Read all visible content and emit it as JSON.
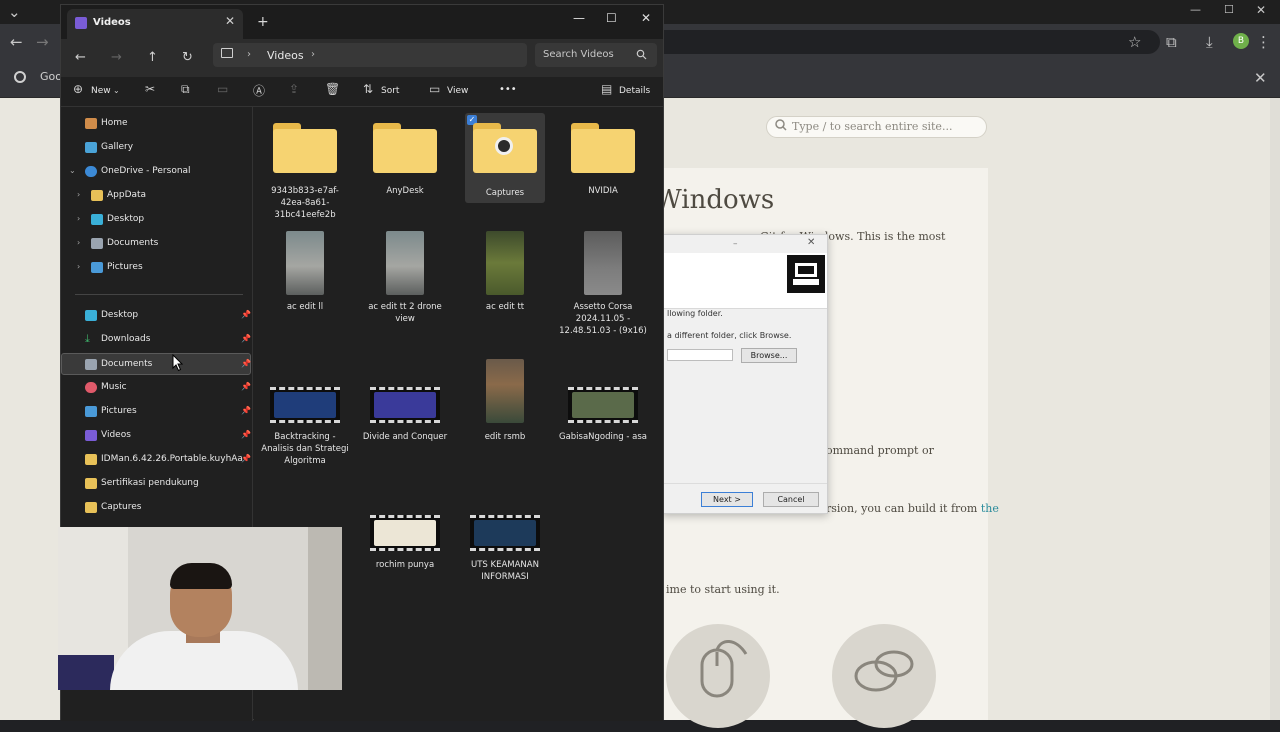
{
  "browser": {
    "bookmark_label": "Goo",
    "search_placeholder": "Type / to search entire site...",
    "heading": "Windows",
    "line1": "Git for Windows. This is the most",
    "line2": "ommand prompt or",
    "line3_text": "rsion, you can build it from",
    "line3_link": "the",
    "line4": "ime to start using it.",
    "profile_initial": "B"
  },
  "installer": {
    "text1": "llowing folder.",
    "text2": "a different folder, click Browse.",
    "browse_label": "Browse...",
    "next_label": "Next >",
    "cancel_label": "Cancel"
  },
  "explorer": {
    "tab_title": "Videos",
    "breadcrumb": "Videos",
    "search_placeholder": "Search Videos",
    "commands": {
      "new": "New",
      "sort": "Sort",
      "view": "View",
      "more": "•••",
      "details": "Details"
    },
    "nav": [
      {
        "label": "Home",
        "color": "#d08c4a"
      },
      {
        "label": "Gallery",
        "color": "#4aa3d8"
      },
      {
        "label": "OneDrive - Personal",
        "color": "#3c8ad6"
      },
      {
        "label": "AppData",
        "color": "#e8c158"
      },
      {
        "label": "Desktop",
        "color": "#3ab0d8"
      },
      {
        "label": "Documents",
        "color": "#9aa4b0"
      },
      {
        "label": "Pictures",
        "color": "#4a9ad8"
      },
      {
        "label": "Desktop",
        "color": "#3ab0d8"
      },
      {
        "label": "Downloads",
        "color": "#3fb56c"
      },
      {
        "label": "Documents",
        "color": "#9aa4b0"
      },
      {
        "label": "Music",
        "color": "#e05a6a"
      },
      {
        "label": "Pictures",
        "color": "#4a9ad8"
      },
      {
        "label": "Videos",
        "color": "#7a5cd6"
      },
      {
        "label": "IDMan.6.42.26.Portable.kuyhAa",
        "color": "#e8c158"
      },
      {
        "label": "Sertifikasi pendukung",
        "color": "#e8c158"
      },
      {
        "label": "Captures",
        "color": "#e8c158"
      }
    ],
    "items": [
      {
        "name": "9343b833-e7af-42ea-8a61-31bc41eefe2b"
      },
      {
        "name": "AnyDesk"
      },
      {
        "name": "Captures"
      },
      {
        "name": "NVIDIA"
      },
      {
        "name": "ac edit ll"
      },
      {
        "name": "ac edit tt 2 drone view"
      },
      {
        "name": "ac edit tt"
      },
      {
        "name": "Assetto Corsa 2024.11.05 - 12.48.51.03 - (9x16)"
      },
      {
        "name": "Backtracking - Analisis dan Strategi Algoritma"
      },
      {
        "name": "Divide and Conquer"
      },
      {
        "name": "edit rsmb"
      },
      {
        "name": "GabisaNgoding - asa"
      },
      {
        "name": "rochim punya"
      },
      {
        "name": "UTS KEAMANAN INFORMASI"
      }
    ]
  }
}
